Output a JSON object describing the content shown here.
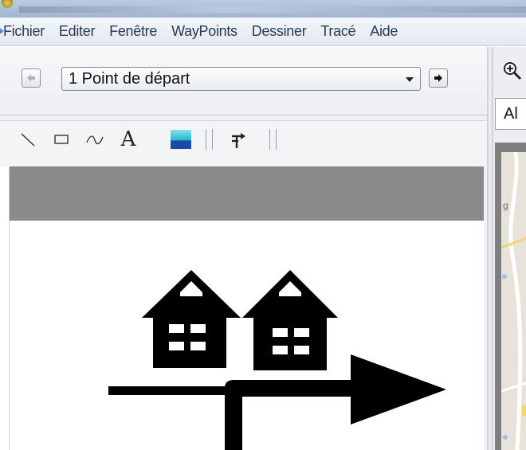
{
  "menu": {
    "items": [
      "Fichier",
      "Editer",
      "Fenêtre",
      "WayPoints",
      "Dessiner",
      "Tracé",
      "Aide"
    ]
  },
  "navigator": {
    "selected_waypoint": "1 Point de départ"
  },
  "drawing_toolbar": {
    "tools": [
      "line-tool",
      "rectangle-tool",
      "curve-tool",
      "text-tool",
      "fill-color-tool",
      "turn-arrow-tool"
    ],
    "text_tool_glyph": "A"
  },
  "right_panel": {
    "field_value": "Al",
    "map_label": "g"
  },
  "colors": {
    "menu_text": "#2c3950",
    "canvas_ink": "#000000",
    "gray_band": "#8a8a8a"
  }
}
